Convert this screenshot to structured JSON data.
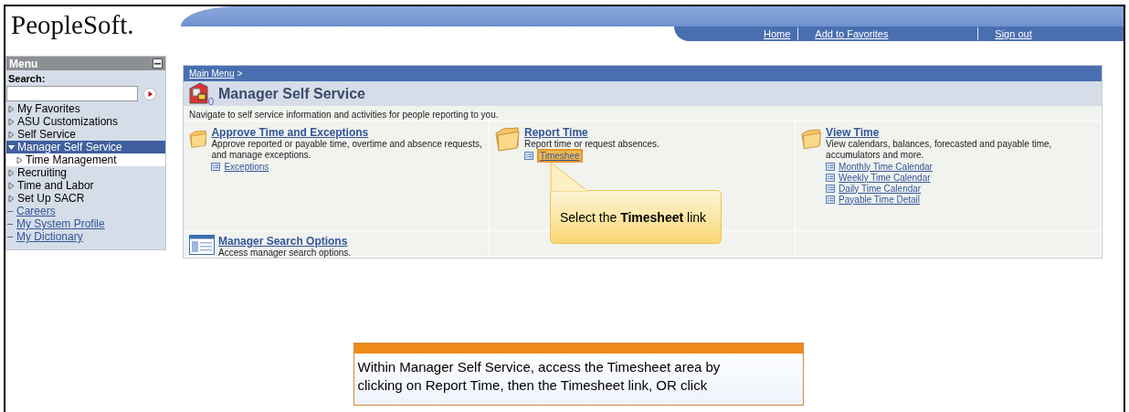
{
  "header": {
    "logo": "PeopleSoft.",
    "links": [
      "Home",
      "Add to Favorites",
      "Sign out"
    ]
  },
  "sidebar": {
    "title": "Menu",
    "search_label": "Search:",
    "items": [
      {
        "label": "My Favorites",
        "kind": "folder",
        "expanded": false,
        "selected": false
      },
      {
        "label": "ASU Customizations",
        "kind": "folder",
        "expanded": false,
        "selected": false
      },
      {
        "label": "Self Service",
        "kind": "folder",
        "expanded": false,
        "selected": false
      },
      {
        "label": "Manager Self Service",
        "kind": "folder",
        "expanded": true,
        "selected": true,
        "children": [
          {
            "label": "Time Management",
            "kind": "folder",
            "expanded": false,
            "selected": false
          }
        ]
      },
      {
        "label": "Recruiting",
        "kind": "folder",
        "expanded": false,
        "selected": false
      },
      {
        "label": "Time and Labor",
        "kind": "folder",
        "expanded": false,
        "selected": false
      },
      {
        "label": "Set Up SACR",
        "kind": "folder",
        "expanded": false,
        "selected": false
      },
      {
        "label": "Careers",
        "kind": "link",
        "selected": false
      },
      {
        "label": "My System Profile",
        "kind": "link",
        "selected": false
      },
      {
        "label": "My Dictionary",
        "kind": "link",
        "selected": false
      }
    ]
  },
  "main": {
    "breadcrumb": "Main Menu",
    "breadcrumb_separator": ">",
    "title": "Manager Self Service",
    "description": "Navigate to self service information and activities for people reporting to you.",
    "tiles": [
      {
        "kind": "folder",
        "title": "Approve Time and Exceptions",
        "description": "Approve reported or payable time, overtime and absence requests, and manage exceptions.",
        "links": [
          {
            "label": "Exceptions",
            "highlighted": false
          }
        ]
      },
      {
        "kind": "folder",
        "title": "Report Time",
        "description": "Report time or request absences.",
        "links": [
          {
            "label": "Timeshee",
            "highlighted": true
          }
        ]
      },
      {
        "kind": "folder",
        "title": "View Time",
        "description": "View calendars, balances, forecasted and payable time, accumulators and more.",
        "links": [
          {
            "label": "Monthly Time Calendar",
            "highlighted": false
          },
          {
            "label": "Weekly Time Calendar",
            "highlighted": false
          },
          {
            "label": "Daily Time Calendar",
            "highlighted": false
          },
          {
            "label": "Payable Time Detail",
            "highlighted": false
          }
        ]
      },
      {
        "kind": "search",
        "title": "Manager Search Options",
        "description": "Access manager search options."
      },
      {
        "kind": "empty"
      },
      {
        "kind": "empty"
      }
    ]
  },
  "callout": {
    "text": "Select the **Timesheet** link"
  },
  "instruction": {
    "text": "Within Manager Self Service, access the Timesheet area by clicking on Report Time, then the Timesheet link, OR click"
  }
}
